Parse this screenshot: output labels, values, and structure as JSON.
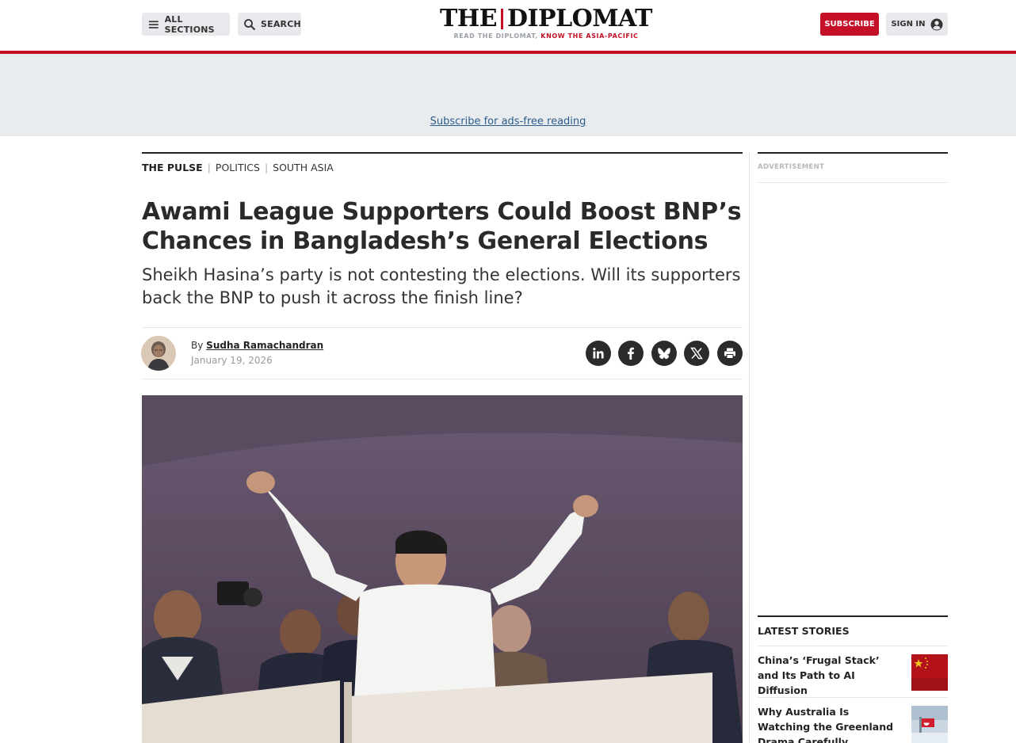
{
  "header": {
    "sections_label": "ALL SECTIONS",
    "search_label": "SEARCH",
    "logo_left": "THE",
    "logo_right": "DIPLOMAT",
    "tagline_grey": "READ THE DIPLOMAT,",
    "tagline_red": "KNOW THE ASIA-PACIFIC",
    "subscribe_label": "SUBSCRIBE",
    "signin_label": "SIGN IN"
  },
  "ad_banner": {
    "link_text": "Subscribe for ads-free reading"
  },
  "article": {
    "breadcrumbs": [
      "THE PULSE",
      "POLITICS",
      "SOUTH ASIA"
    ],
    "title": "Awami League Supporters Could Boost BNP’s Chances in Bangladesh’s General Elections",
    "subtitle": "Sheikh Hasina’s party is not contesting the elections. Will its supporters back the BNP to push it across the finish line?",
    "by_label": "By",
    "author": "Sudha Ramachandran",
    "date": "January 19, 2026",
    "share_icons": [
      "linkedin-icon",
      "facebook-icon",
      "bluesky-icon",
      "x-icon",
      "print-icon"
    ]
  },
  "sidebar": {
    "ad_label": "ADVERTISEMENT",
    "latest_label": "LATEST STORIES",
    "stories": [
      {
        "title": "China’s ‘Frugal Stack’ and Its Path to AI Diffusion"
      },
      {
        "title": "Why Australia Is Watching the Greenland Drama Carefully"
      }
    ]
  },
  "colors": {
    "brand_red": "#c40f26",
    "link_blue": "#2c5d8c",
    "button_grey": "#e7e9ec"
  }
}
